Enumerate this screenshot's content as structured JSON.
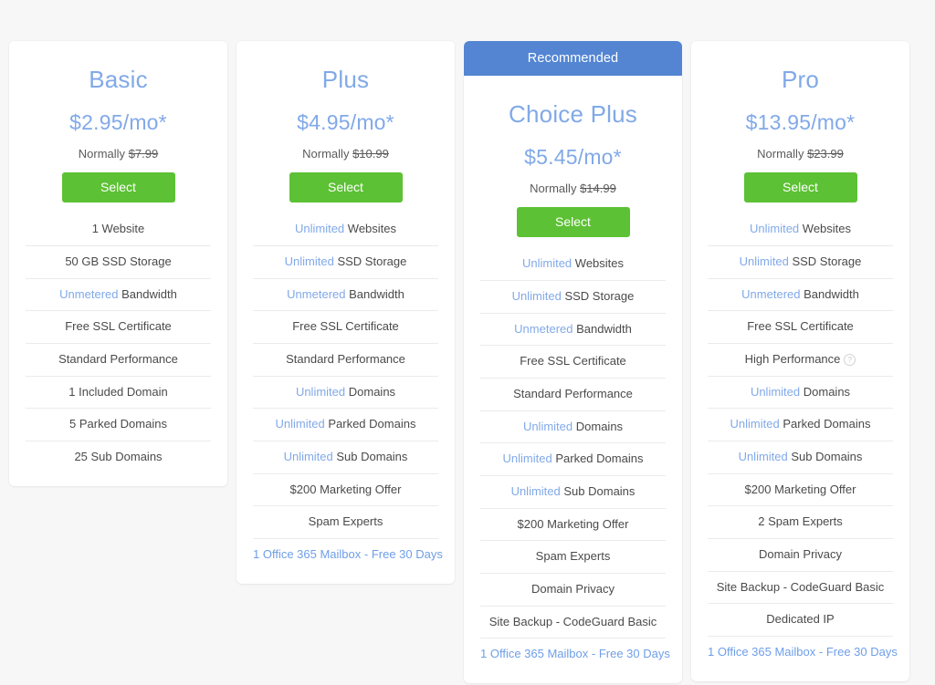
{
  "accent": {
    "blue": "#81a9e8",
    "banner_blue": "#5385d2",
    "green": "#5cc134",
    "link_blue": "#6e9ee8",
    "text_gray": "#4a4a4a",
    "background": "#f7f7f8"
  },
  "labels": {
    "normally_prefix": "Normally",
    "select": "Select",
    "recommended": "Recommended",
    "info_glyph": "?"
  },
  "plans": [
    {
      "name": "Basic",
      "price": "$2.95/mo*",
      "normally_prefix": "Normally",
      "normally_price": "$7.99",
      "select_label": "Select",
      "recommended": false,
      "features": [
        {
          "highlight": "",
          "text": "1 Website",
          "link": false,
          "info": false
        },
        {
          "highlight": "",
          "text": "50 GB SSD Storage",
          "link": false,
          "info": false
        },
        {
          "highlight": "Unmetered",
          "text": "Bandwidth",
          "link": false,
          "info": false
        },
        {
          "highlight": "",
          "text": "Free SSL Certificate",
          "link": false,
          "info": false
        },
        {
          "highlight": "",
          "text": "Standard Performance",
          "link": false,
          "info": false
        },
        {
          "highlight": "",
          "text": "1 Included Domain",
          "link": false,
          "info": false
        },
        {
          "highlight": "",
          "text": "5 Parked Domains",
          "link": false,
          "info": false
        },
        {
          "highlight": "",
          "text": "25 Sub Domains",
          "link": false,
          "info": false
        }
      ]
    },
    {
      "name": "Plus",
      "price": "$4.95/mo*",
      "normally_prefix": "Normally",
      "normally_price": "$10.99",
      "select_label": "Select",
      "recommended": false,
      "features": [
        {
          "highlight": "Unlimited",
          "text": "Websites",
          "link": false,
          "info": false
        },
        {
          "highlight": "Unlimited",
          "text": "SSD Storage",
          "link": false,
          "info": false
        },
        {
          "highlight": "Unmetered",
          "text": "Bandwidth",
          "link": false,
          "info": false
        },
        {
          "highlight": "",
          "text": "Free SSL Certificate",
          "link": false,
          "info": false
        },
        {
          "highlight": "",
          "text": "Standard Performance",
          "link": false,
          "info": false
        },
        {
          "highlight": "Unlimited",
          "text": "Domains",
          "link": false,
          "info": false
        },
        {
          "highlight": "Unlimited",
          "text": "Parked Domains",
          "link": false,
          "info": false
        },
        {
          "highlight": "Unlimited",
          "text": "Sub Domains",
          "link": false,
          "info": false
        },
        {
          "highlight": "",
          "text": "$200 Marketing Offer",
          "link": false,
          "info": false
        },
        {
          "highlight": "",
          "text": "Spam Experts",
          "link": false,
          "info": false
        },
        {
          "highlight": "",
          "text": "1 Office 365 Mailbox - Free 30 Days",
          "link": true,
          "info": false
        }
      ]
    },
    {
      "name": "Choice Plus",
      "price": "$5.45/mo*",
      "normally_prefix": "Normally",
      "normally_price": "$14.99",
      "select_label": "Select",
      "recommended": true,
      "recommended_label": "Recommended",
      "features": [
        {
          "highlight": "Unlimited",
          "text": "Websites",
          "link": false,
          "info": false
        },
        {
          "highlight": "Unlimited",
          "text": "SSD Storage",
          "link": false,
          "info": false
        },
        {
          "highlight": "Unmetered",
          "text": "Bandwidth",
          "link": false,
          "info": false
        },
        {
          "highlight": "",
          "text": "Free SSL Certificate",
          "link": false,
          "info": false
        },
        {
          "highlight": "",
          "text": "Standard Performance",
          "link": false,
          "info": false
        },
        {
          "highlight": "Unlimited",
          "text": "Domains",
          "link": false,
          "info": false
        },
        {
          "highlight": "Unlimited",
          "text": "Parked Domains",
          "link": false,
          "info": false
        },
        {
          "highlight": "Unlimited",
          "text": "Sub Domains",
          "link": false,
          "info": false
        },
        {
          "highlight": "",
          "text": "$200 Marketing Offer",
          "link": false,
          "info": false
        },
        {
          "highlight": "",
          "text": "Spam Experts",
          "link": false,
          "info": false
        },
        {
          "highlight": "",
          "text": "Domain Privacy",
          "link": false,
          "info": false
        },
        {
          "highlight": "",
          "text": "Site Backup - CodeGuard Basic",
          "link": false,
          "info": false
        },
        {
          "highlight": "",
          "text": "1 Office 365 Mailbox - Free 30 Days",
          "link": true,
          "info": false
        }
      ]
    },
    {
      "name": "Pro",
      "price": "$13.95/mo*",
      "normally_prefix": "Normally",
      "normally_price": "$23.99",
      "select_label": "Select",
      "recommended": false,
      "features": [
        {
          "highlight": "Unlimited",
          "text": "Websites",
          "link": false,
          "info": false
        },
        {
          "highlight": "Unlimited",
          "text": "SSD Storage",
          "link": false,
          "info": false
        },
        {
          "highlight": "Unmetered",
          "text": "Bandwidth",
          "link": false,
          "info": false
        },
        {
          "highlight": "",
          "text": "Free SSL Certificate",
          "link": false,
          "info": false
        },
        {
          "highlight": "",
          "text": "High Performance",
          "link": false,
          "info": true
        },
        {
          "highlight": "Unlimited",
          "text": "Domains",
          "link": false,
          "info": false
        },
        {
          "highlight": "Unlimited",
          "text": "Parked Domains",
          "link": false,
          "info": false
        },
        {
          "highlight": "Unlimited",
          "text": "Sub Domains",
          "link": false,
          "info": false
        },
        {
          "highlight": "",
          "text": "$200 Marketing Offer",
          "link": false,
          "info": false
        },
        {
          "highlight": "",
          "text": "2 Spam Experts",
          "link": false,
          "info": false
        },
        {
          "highlight": "",
          "text": "Domain Privacy",
          "link": false,
          "info": false
        },
        {
          "highlight": "",
          "text": "Site Backup - CodeGuard Basic",
          "link": false,
          "info": false
        },
        {
          "highlight": "",
          "text": "Dedicated IP",
          "link": false,
          "info": false
        },
        {
          "highlight": "",
          "text": "1 Office 365 Mailbox - Free 30 Days",
          "link": true,
          "info": false
        }
      ]
    }
  ]
}
